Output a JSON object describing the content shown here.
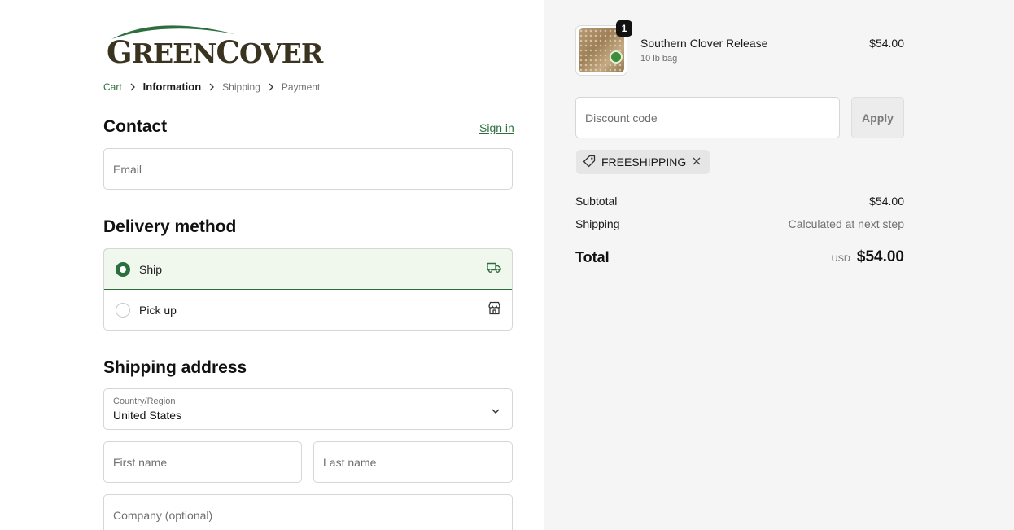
{
  "brand": {
    "logo_text_first": "G",
    "logo_text_rest1": "REEN",
    "logo_text_second": "C",
    "logo_text_rest2": "OVER",
    "logo_color": "#3a3320",
    "accent_color": "#2c6e3d"
  },
  "breadcrumb": {
    "items": [
      {
        "label": "Cart",
        "state": "link"
      },
      {
        "label": "Information",
        "state": "current"
      },
      {
        "label": "Shipping",
        "state": "upcoming"
      },
      {
        "label": "Payment",
        "state": "upcoming"
      }
    ]
  },
  "contact": {
    "heading": "Contact",
    "sign_in": "Sign in",
    "email_placeholder": "Email"
  },
  "delivery": {
    "heading": "Delivery method",
    "options": [
      {
        "label": "Ship",
        "selected": true,
        "icon": "truck-icon"
      },
      {
        "label": "Pick up",
        "selected": false,
        "icon": "store-icon"
      }
    ]
  },
  "shipping_address": {
    "heading": "Shipping address",
    "country_label": "Country/Region",
    "country_value": "United States",
    "first_name_placeholder": "First name",
    "last_name_placeholder": "Last name",
    "company_placeholder": "Company (optional)"
  },
  "order": {
    "item": {
      "name": "Southern Clover Release",
      "variant": "10 lb bag",
      "price": "$54.00",
      "quantity": "1"
    },
    "discount_placeholder": "Discount code",
    "apply_label": "Apply",
    "applied_code": "FREESHIPPING",
    "subtotal_label": "Subtotal",
    "subtotal_value": "$54.00",
    "shipping_label": "Shipping",
    "shipping_value": "Calculated at next step",
    "total_label": "Total",
    "total_currency": "USD",
    "total_value": "$54.00"
  }
}
